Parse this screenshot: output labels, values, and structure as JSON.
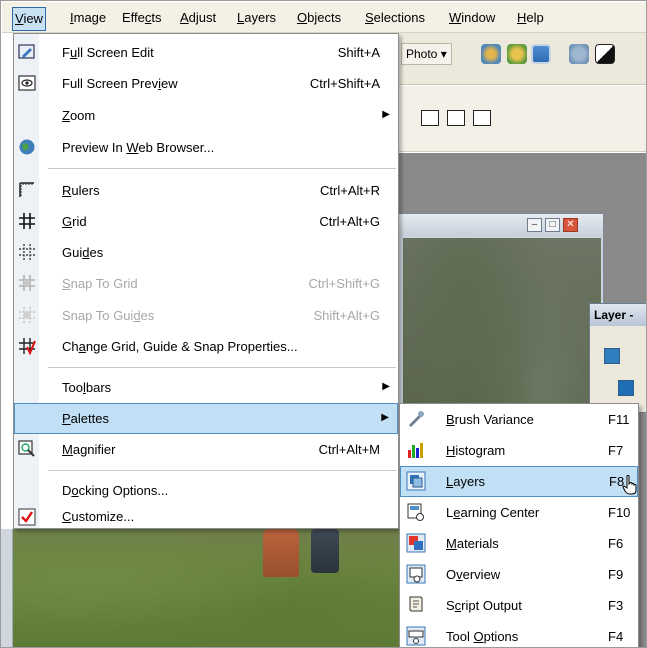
{
  "menubar": {
    "items": [
      {
        "label": "View",
        "u": 0,
        "active": true
      },
      {
        "label": "Image",
        "u": 0
      },
      {
        "label": "Effects",
        "u": 4
      },
      {
        "label": "Adjust",
        "u": 0
      },
      {
        "label": "Layers",
        "u": 0
      },
      {
        "label": "Objects",
        "u": 0
      },
      {
        "label": "Selections",
        "u": 0
      },
      {
        "label": "Window",
        "u": 0
      },
      {
        "label": "Help",
        "u": 0
      }
    ]
  },
  "background": {
    "photo_dropdown": "Photo",
    "layer_palette_title": "Layer -"
  },
  "view_menu": {
    "items": [
      {
        "label": "Full Screen Edit",
        "shortcut": "Shift+A",
        "icon": "full-screen-edit-icon",
        "mnemonic": "u"
      },
      {
        "label": "Full Screen Preview",
        "shortcut": "Ctrl+Shift+A",
        "icon": "preview-eye-icon",
        "mnemonic": "i"
      },
      {
        "label": "Zoom",
        "submenu": true,
        "mnemonic": "Z"
      },
      {
        "label": "Preview In Web Browser...",
        "icon": "globe-icon",
        "mnemonic": "W"
      },
      {
        "label": "Rulers",
        "shortcut": "Ctrl+Alt+R",
        "icon": "ruler-icon",
        "mnemonic": "R"
      },
      {
        "label": "Grid",
        "shortcut": "Ctrl+Alt+G",
        "icon": "grid-icon",
        "mnemonic": "G"
      },
      {
        "label": "Guides",
        "icon": "guides-icon",
        "mnemonic": "d"
      },
      {
        "label": "Snap To Grid",
        "shortcut": "Ctrl+Shift+G",
        "icon": "snap-grid-icon",
        "disabled": true,
        "mnemonic": "S"
      },
      {
        "label": "Snap To Guides",
        "shortcut": "Shift+Alt+G",
        "icon": "snap-guides-icon",
        "disabled": true,
        "mnemonic": "d"
      },
      {
        "label": "Change Grid, Guide & Snap Properties...",
        "icon": "grid-properties-icon",
        "mnemonic": "a"
      },
      {
        "label": "Toolbars",
        "submenu": true,
        "mnemonic": "l"
      },
      {
        "label": "Palettes",
        "submenu": true,
        "highlighted": true,
        "mnemonic": "P"
      },
      {
        "label": "Magnifier",
        "shortcut": "Ctrl+Alt+M",
        "icon": "magnifier-icon",
        "mnemonic": "M"
      },
      {
        "label": "Docking Options...",
        "mnemonic": "o"
      },
      {
        "label": "Customize...",
        "icon": "customize-check-icon",
        "mnemonic": "C"
      }
    ]
  },
  "palettes_submenu": {
    "items": [
      {
        "label": "Brush Variance",
        "shortcut": "F11",
        "icon": "brush-variance-icon",
        "mnemonic": "B"
      },
      {
        "label": "Histogram",
        "shortcut": "F7",
        "icon": "histogram-icon",
        "mnemonic": "H"
      },
      {
        "label": "Layers",
        "shortcut": "F8",
        "icon": "layers-icon",
        "highlighted": true,
        "mnemonic": "L"
      },
      {
        "label": "Learning Center",
        "shortcut": "F10",
        "icon": "learning-center-icon",
        "mnemonic": "e"
      },
      {
        "label": "Materials",
        "shortcut": "F6",
        "icon": "materials-icon",
        "mnemonic": "M"
      },
      {
        "label": "Overview",
        "shortcut": "F9",
        "icon": "overview-icon",
        "mnemonic": "v"
      },
      {
        "label": "Script Output",
        "shortcut": "F3",
        "icon": "script-output-icon",
        "mnemonic": "c"
      },
      {
        "label": "Tool Options",
        "shortcut": "F4",
        "icon": "tool-options-icon",
        "mnemonic": "O"
      }
    ]
  }
}
